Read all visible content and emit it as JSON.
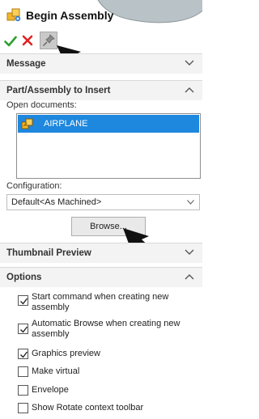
{
  "window": {
    "title": "Begin Assembly",
    "icons": {
      "title": "assembly-icon",
      "ok": "check-icon",
      "cancel": "close-icon",
      "pin": "pushpin-icon"
    }
  },
  "sections": {
    "message": {
      "label": "Message",
      "state": "collapsed"
    },
    "part_insert": {
      "label": "Part/Assembly to Insert",
      "state": "expanded",
      "open_documents_label": "Open documents:",
      "documents": [
        {
          "name": "AIRPLANE",
          "selected": true,
          "icon": "assembly-icon"
        }
      ],
      "configuration_label": "Configuration:",
      "configuration_value": "Default<As Machined>",
      "browse_label": "Browse..."
    },
    "thumbnail": {
      "label": "Thumbnail Preview",
      "state": "collapsed"
    },
    "options": {
      "label": "Options",
      "state": "expanded",
      "items": [
        {
          "label_line1": "Start command when creating new",
          "label_line2": "assembly",
          "checked": true
        },
        {
          "label_line1": "Automatic Browse when creating new",
          "label_line2": "assembly",
          "checked": true
        },
        {
          "label_line1": "Graphics preview",
          "checked": true
        },
        {
          "label_line1": "Make virtual",
          "checked": false
        },
        {
          "label_line1": "Envelope",
          "checked": false
        },
        {
          "label_line1": "Show Rotate context toolbar",
          "checked": false
        }
      ]
    }
  },
  "colors": {
    "selection": "#1e87de",
    "ok": "#2ca02c",
    "cancel": "#e02020",
    "header_bg": "#f3f3f3"
  }
}
